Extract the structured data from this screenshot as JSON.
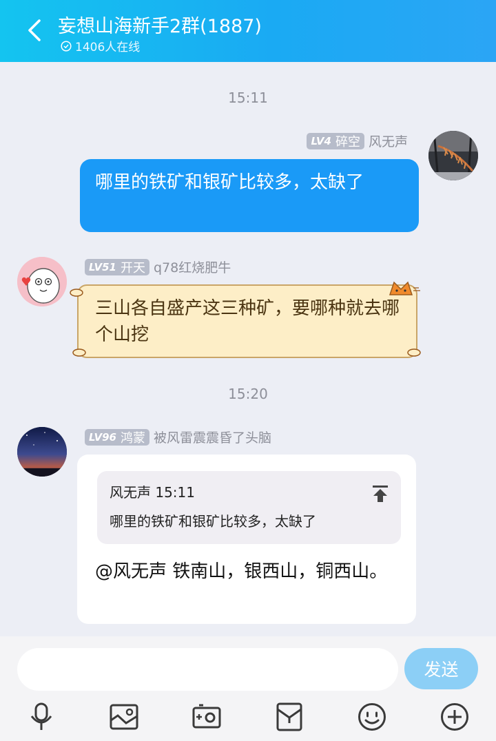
{
  "header": {
    "title": "妄想山海新手2群(1887)",
    "online": "1406人在线"
  },
  "timestamps": [
    "15:11",
    "15:20"
  ],
  "messages": [
    {
      "level": "LV4",
      "title": "碎空",
      "name": "风无声",
      "text": "哪里的铁矿和银矿比较多，太缺了"
    },
    {
      "level": "LV51",
      "title": "开天",
      "name": "q78红烧肥牛",
      "text": "三山各自盛产这三种矿，要哪种就去哪个山挖"
    },
    {
      "level": "LV96",
      "title": "鸿蒙",
      "name": "被风雷震震昏了头脑",
      "quote_header": "风无声 15:11",
      "quote_text": "哪里的铁矿和银矿比较多，太缺了",
      "text": "@风无声 铁南山，银西山，铜西山。"
    }
  ],
  "composer": {
    "send_label": "发送"
  },
  "colors": {
    "header_start": "#14c4f0",
    "header_end": "#2ba5f5",
    "own_bubble": "#1a9af7",
    "cat_bubble": "#fdeec7",
    "send_button": "#8ccff6"
  }
}
